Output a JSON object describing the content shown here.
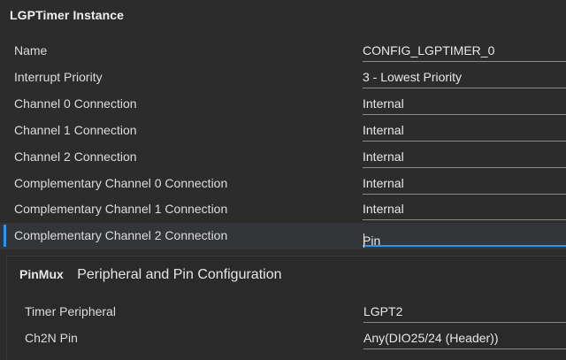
{
  "section": {
    "title": "LGPTimer Instance"
  },
  "fields": [
    {
      "label": "Name",
      "value": "CONFIG_LGPTIMER_0"
    },
    {
      "label": "Interrupt Priority",
      "value": "3 - Lowest Priority"
    },
    {
      "label": "Channel 0 Connection",
      "value": "Internal"
    },
    {
      "label": "Channel 1 Connection",
      "value": "Internal"
    },
    {
      "label": "Channel 2 Connection",
      "value": "Internal"
    },
    {
      "label": "Complementary Channel 0 Connection",
      "value": "Internal"
    },
    {
      "label": "Complementary Channel 1 Connection",
      "value": "Internal"
    },
    {
      "label": "Complementary Channel 2 Connection",
      "value": "Pin"
    }
  ],
  "pinmux": {
    "tag": "PinMux",
    "title": "Peripheral and Pin Configuration",
    "fields": [
      {
        "label": "Timer Peripheral",
        "value": "LGPT2"
      },
      {
        "label": "Ch2N Pin",
        "value": "Any(DIO25/24 (Header))"
      }
    ]
  },
  "colors": {
    "accent": "#3d8fe0",
    "background": "#2c2c2c"
  }
}
